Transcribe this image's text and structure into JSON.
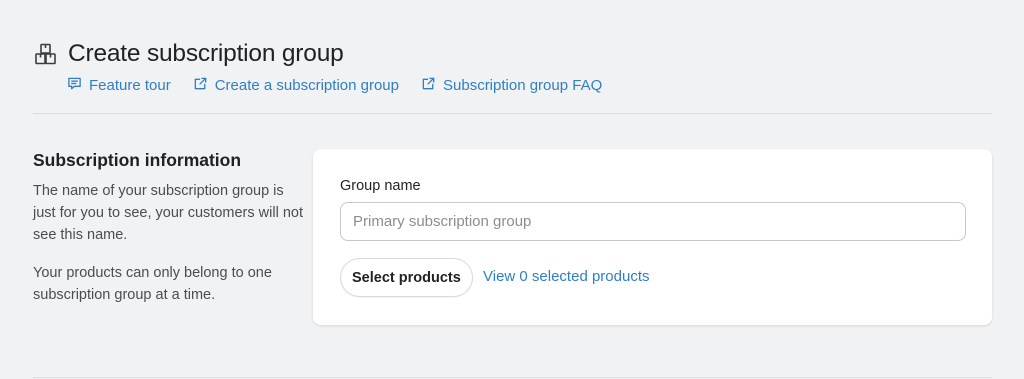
{
  "header": {
    "title": "Create subscription group",
    "title_icon": "boxes-icon",
    "links": [
      {
        "label": "Feature tour",
        "icon": "chat-icon"
      },
      {
        "label": "Create a subscription group",
        "icon": "external-link-icon"
      },
      {
        "label": "Subscription group FAQ",
        "icon": "external-link-icon"
      }
    ]
  },
  "info": {
    "title": "Subscription information",
    "paragraphs": [
      "The name of your subscription group is just for you to see, your customers will not see this name.",
      "Your products can only belong to one subscription group at a time."
    ]
  },
  "form": {
    "group_name_label": "Group name",
    "group_name_value": "",
    "group_name_placeholder": "Primary subscription group",
    "select_button_label": "Select products",
    "view_selected_link": "View 0 selected products"
  },
  "colors": {
    "background": "#f1f2f4",
    "link": "#2f7fc4",
    "card": "#ffffff"
  }
}
